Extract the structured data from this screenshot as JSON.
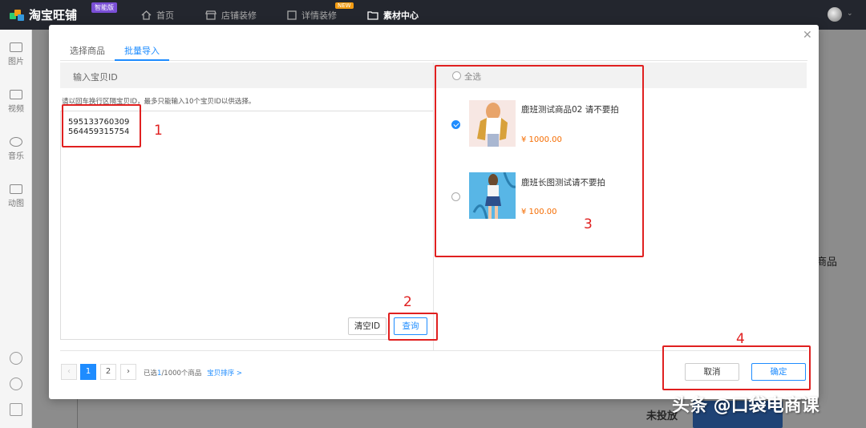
{
  "topbar": {
    "logo_text": "淘宝旺铺",
    "edition_badge": "智能版",
    "nav": [
      {
        "label": "首页",
        "icon": "home-icon"
      },
      {
        "label": "店铺装修",
        "icon": "store-icon"
      },
      {
        "label": "详情装修",
        "icon": "detail-icon",
        "badge": "NEW"
      },
      {
        "label": "素材中心",
        "icon": "folder-icon",
        "active": true
      }
    ]
  },
  "sidebar": {
    "items": [
      {
        "label": "图片",
        "icon": "image-icon"
      },
      {
        "label": "视频",
        "icon": "video-icon"
      },
      {
        "label": "音乐",
        "icon": "music-icon"
      },
      {
        "label": "动图",
        "icon": "gif-icon"
      }
    ]
  },
  "background": {
    "right_text": "商品",
    "bottom_status": "未投放"
  },
  "modal": {
    "tabs": [
      {
        "label": "选择商品"
      },
      {
        "label": "批量导入",
        "active": true
      }
    ],
    "input_title": "输入宝贝ID",
    "hint": "请以回车换行区隔宝贝ID，最多只能输入10个宝贝ID以供选择。",
    "textarea_value": "595133760309\n564459315754",
    "clear_btn": "清空ID",
    "query_btn": "查询",
    "select_all": "全选",
    "products": [
      {
        "name": "鹿班测试商品02 请不要拍",
        "price": "¥ 1000.00",
        "selected": true
      },
      {
        "name": "鹿班长图测试请不要拍",
        "price": "¥ 100.00",
        "selected": false
      }
    ],
    "pagination": {
      "prev": "‹",
      "pages": [
        "1",
        "2"
      ],
      "next": "›",
      "current": 1
    },
    "selection_prefix": "已选",
    "selection_count": "1",
    "selection_suffix": "/1000个商品",
    "sort_link": "宝贝排序 >",
    "cancel_btn": "取消",
    "confirm_btn": "确定"
  },
  "annotations": [
    "1",
    "2",
    "3",
    "4"
  ],
  "watermark": "头条 @口袋电商课",
  "colors": {
    "accent": "#1e8cff",
    "price": "#f56c00",
    "annotation": "#e02020",
    "topbar": "#23262e"
  }
}
